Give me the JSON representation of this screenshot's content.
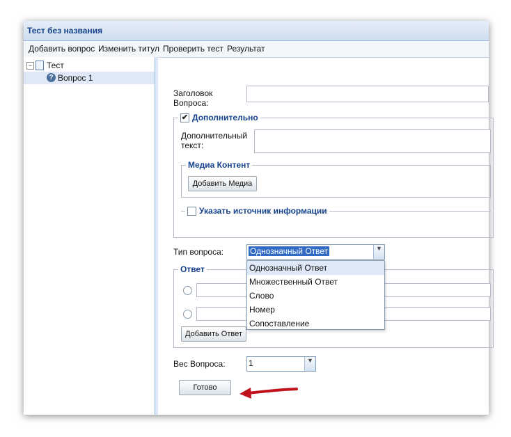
{
  "window": {
    "title": "Тест без названия"
  },
  "menu": [
    "Добавить вопрос",
    "Изменить титул",
    "Проверить тест",
    "Результат"
  ],
  "tree": {
    "root": "Тест",
    "child": "Вопрос 1"
  },
  "form": {
    "question_title_label": "Заголовок Вопроса:",
    "additional": {
      "legend": "Дополнительно",
      "checked": true,
      "text_label": "Дополнительный текст:"
    },
    "media": {
      "legend": "Медиа Контент",
      "button": "Добавить Медиа"
    },
    "source": {
      "legend": "Указать источник информации",
      "checked": false
    },
    "question_type": {
      "label": "Тип вопроса:",
      "value": "Однозначный Ответ",
      "options": [
        "Однозначный Ответ",
        "Множественный Ответ",
        "Слово",
        "Номер",
        "Сопоставление"
      ]
    },
    "answer": {
      "legend": "Ответ",
      "add_button": "Добавить Ответ"
    },
    "weight": {
      "label": "Вес Вопроса:",
      "value": "1"
    },
    "done_button": "Готово"
  },
  "colors": {
    "title_text": "#15428b",
    "arrow": "#c0121a",
    "selection": "#316ac5"
  }
}
